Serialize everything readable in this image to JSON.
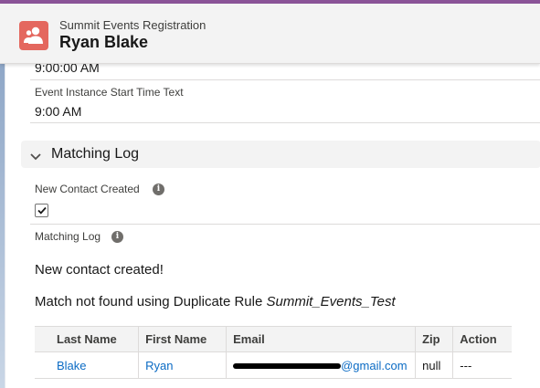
{
  "header": {
    "object_name": "Summit Events Registration",
    "record_name": "Ryan Blake",
    "icon": "contacts-icon",
    "icon_color": "#e4675e",
    "accent_color": "#8a5397"
  },
  "fields": {
    "partial_value": "9:00:00 AM",
    "start_time_text_label": "Event Instance Start Time Text",
    "start_time_text_value": "9:00 AM"
  },
  "section": {
    "title": "Matching Log"
  },
  "new_contact": {
    "label": "New Contact Created",
    "checked": true
  },
  "matching_log": {
    "label": "Matching Log",
    "line1": "New contact created!",
    "line2_prefix": "Match not found using Duplicate Rule ",
    "line2_rule": "Summit_Events_Test"
  },
  "table": {
    "columns": [
      "Last Name",
      "First Name",
      "Email",
      "Zip",
      "Action"
    ],
    "rows": [
      {
        "last_name": "Blake",
        "first_name": "Ryan",
        "email_visible": "@gmail.com",
        "zip": "null",
        "action": "---"
      }
    ]
  }
}
